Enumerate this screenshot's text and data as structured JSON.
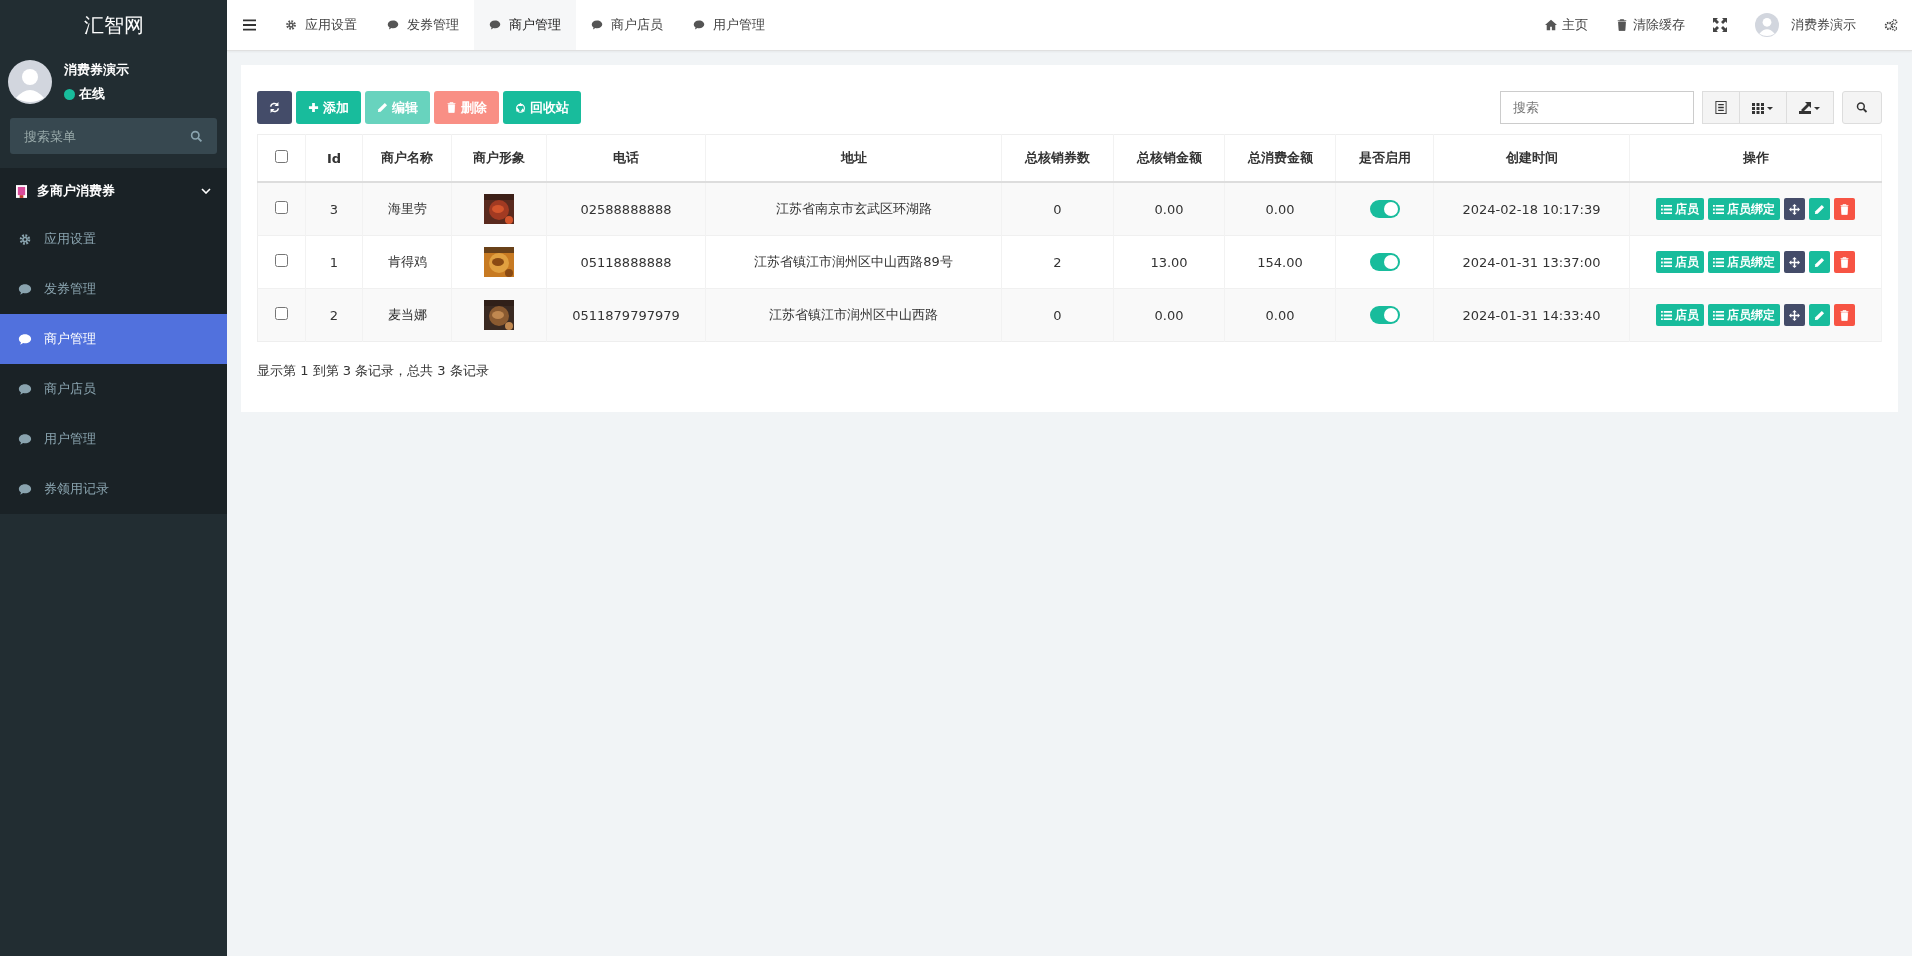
{
  "sidebar": {
    "logo": "汇智网",
    "user": {
      "name": "消费券演示",
      "status": "在线"
    },
    "search": {
      "placeholder": "搜索菜单"
    },
    "group": {
      "title": "多商户消费券",
      "expanded": true
    },
    "items": [
      {
        "label": "应用设置",
        "kind": "settings",
        "selected": false
      },
      {
        "label": "发券管理",
        "kind": "chat",
        "selected": false
      },
      {
        "label": "商户管理",
        "kind": "chat",
        "selected": true
      },
      {
        "label": "商户店员",
        "kind": "chat",
        "selected": false
      },
      {
        "label": "用户管理",
        "kind": "chat",
        "selected": false
      },
      {
        "label": "券领用记录",
        "kind": "chat",
        "selected": false
      }
    ]
  },
  "topbar": {
    "tabs": [
      {
        "label": "应用设置",
        "kind": "settings",
        "selected": false
      },
      {
        "label": "发券管理",
        "kind": "chat",
        "selected": false
      },
      {
        "label": "商户管理",
        "kind": "chat",
        "selected": true
      },
      {
        "label": "商户店员",
        "kind": "chat",
        "selected": false
      },
      {
        "label": "用户管理",
        "kind": "chat",
        "selected": false
      }
    ],
    "home": "主页",
    "clear_cache": "清除缓存",
    "user": "消费券演示"
  },
  "toolbar": {
    "buttons": [
      {
        "kind": "refresh",
        "disabled": false
      },
      {
        "kind": "add",
        "label": "添加",
        "disabled": false
      },
      {
        "kind": "edit",
        "label": "编辑",
        "disabled": true
      },
      {
        "kind": "delete",
        "label": "删除",
        "disabled": true
      },
      {
        "kind": "recycle",
        "label": "回收站",
        "disabled": false
      }
    ],
    "search": {
      "placeholder": "搜索"
    }
  },
  "table": {
    "select_all": {
      "checked": false
    },
    "columns": [
      "Id",
      "商户名称",
      "商户形象",
      "电话",
      "地址",
      "总核销券数",
      "总核销金额",
      "总消费金额",
      "是否启用",
      "创建时间",
      "操作"
    ],
    "rows": [
      {
        "checked": false,
        "id": "3",
        "name": "海里劳",
        "image": {
          "kind": "picture"
        },
        "phone": "02588888888",
        "address": "江苏省南京市玄武区环湖路",
        "count": "0",
        "verified": "0.00",
        "spent": "0.00",
        "enabled": true,
        "created": "2024-02-18 10:17:39",
        "actions": [
          {
            "kind": "list",
            "label": "店员"
          },
          {
            "kind": "list",
            "label": "店员绑定"
          },
          {
            "kind": "move"
          },
          {
            "kind": "edit"
          },
          {
            "kind": "delete"
          }
        ]
      },
      {
        "checked": false,
        "id": "1",
        "name": "肯得鸡",
        "image": {
          "kind": "picture"
        },
        "phone": "05118888888",
        "address": "江苏省镇江市润州区中山西路89号",
        "count": "2",
        "verified": "13.00",
        "spent": "154.00",
        "enabled": true,
        "created": "2024-01-31 13:37:00",
        "actions": [
          {
            "kind": "list",
            "label": "店员"
          },
          {
            "kind": "list",
            "label": "店员绑定"
          },
          {
            "kind": "move"
          },
          {
            "kind": "edit"
          },
          {
            "kind": "delete"
          }
        ]
      },
      {
        "checked": false,
        "id": "2",
        "name": "麦当娜",
        "image": {
          "kind": "picture"
        },
        "phone": "0511879797979",
        "address": "江苏省镇江市润州区中山西路",
        "count": "0",
        "verified": "0.00",
        "spent": "0.00",
        "enabled": true,
        "created": "2024-01-31 14:33:40",
        "actions": [
          {
            "kind": "list",
            "label": "店员"
          },
          {
            "kind": "list",
            "label": "店员绑定"
          },
          {
            "kind": "move"
          },
          {
            "kind": "edit"
          },
          {
            "kind": "delete"
          }
        ]
      }
    ]
  },
  "footer": "显示第 1 到第 3 条记录，总共 3 条记录"
}
